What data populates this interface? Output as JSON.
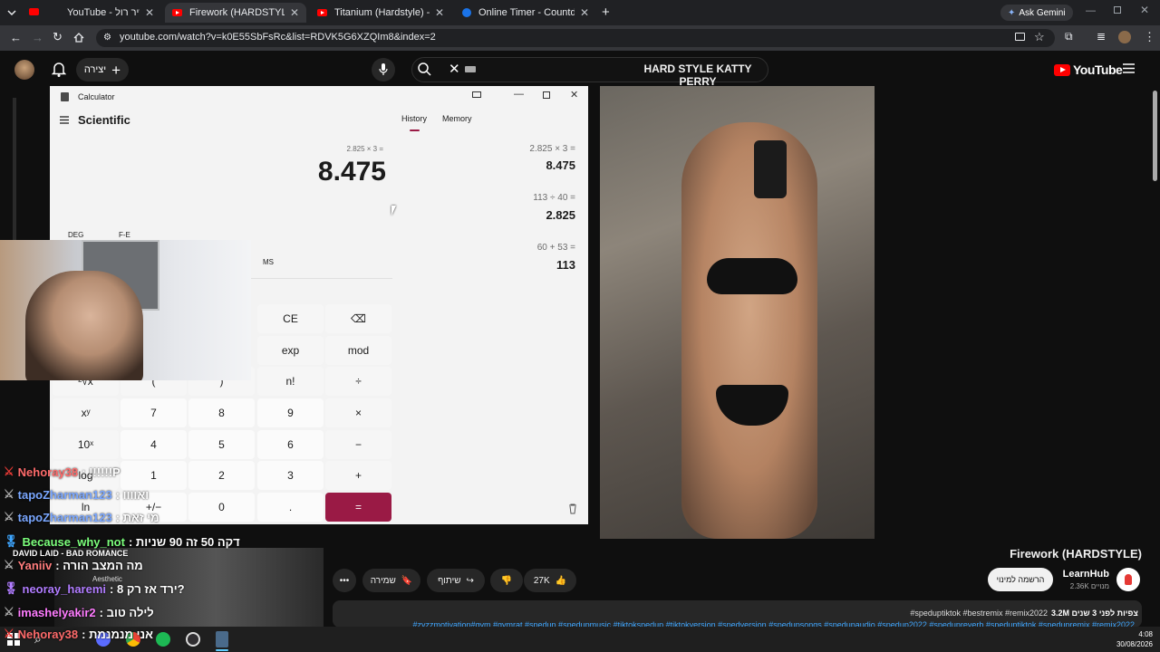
{
  "browser": {
    "tabs": [
      {
        "label": "YouTube - אבא קריר רול"
      },
      {
        "label": "Firework (HARDSTYLE) - YouTube"
      },
      {
        "label": "Titanium (Hardstyle) - YouTube"
      },
      {
        "label": "Online Timer - Countdown - vC"
      }
    ],
    "ask_gemini": "Ask Gemini",
    "url": "youtube.com/watch?v=k0E55SbFsRc&list=RDVK5G6XZQIm8&index=2"
  },
  "youtube": {
    "create_label": "יצירה",
    "search_query": "HARD STYLE KATTY PERRY",
    "logo": "YouTube",
    "video_title": "Firework (HARDSTYLE)",
    "channel_name": "LearnHub",
    "subscribers": "2.36K מנויים",
    "subscribe_label": "הרשמה למינוי",
    "likes": "27K",
    "share_label": "שיתוף",
    "save_label": "שמירה",
    "views_line": "3.2M צפיות לפני 3 שנים",
    "hashtags_1": "#speduptiktok #bestremix #remix2022",
    "hashtags_2": "#zyzzmotivation#gym #gymrat #spedup #spedupmusic #tiktokspedup #tiktokversion #spedversion #spedupsongs #spedupaudio #spedup2022 #spedupreverb #speduptiktok #spedupremix #remix2022"
  },
  "calculator": {
    "title": "Calculator",
    "mode": "Scientific",
    "tab_history": "History",
    "tab_memory": "Memory",
    "expression": "2.825 × 3 =",
    "display": "8.475",
    "deg": "DEG",
    "fe": "F-E",
    "ms": "MS",
    "history": [
      {
        "expr": "2.825  ×  3 =",
        "result": "8.475"
      },
      {
        "expr": "113  ÷  40 =",
        "result": "2.825"
      },
      {
        "expr": "60  +  53 =",
        "result": "113"
      }
    ],
    "keys": {
      "ce": "CE",
      "back": "⌫",
      "exp": "exp",
      "mod": "mod",
      "sqrt": "²√x",
      "lparen": "(",
      "rparen": ")",
      "fact": "n!",
      "div": "÷",
      "xy": "xʸ",
      "k7": "7",
      "k8": "8",
      "k9": "9",
      "mul": "×",
      "tenx": "10ˣ",
      "k4": "4",
      "k5": "5",
      "k6": "6",
      "minus": "−",
      "log": "log",
      "k1": "1",
      "k2": "2",
      "k3": "3",
      "plus": "+",
      "ln": "ln",
      "neg": "+/−",
      "k0": "0",
      "dot": ".",
      "eq": "="
    }
  },
  "chat": [
    {
      "nick": "Nehoray38",
      "msg": ": !!!!!!P",
      "color": "#ff6b6b"
    },
    {
      "nick": "tapoZharman123",
      "msg": ": ואוווו",
      "color": "#7aa7ff"
    },
    {
      "nick": "tapoZharman123",
      "msg": ": מי זאת",
      "color": "#7aa7ff"
    },
    {
      "nick": "Because_why_not",
      "msg": ": דקה 50 זה 90 שניות",
      "color": "#7cff7c"
    },
    {
      "nick": "Yaniiv",
      "msg": ": מה המצב הורה",
      "color": "#ff7c7c"
    },
    {
      "nick": "neoray_haremi",
      "msg": ": ירד אז רק 8?",
      "color": "#b07cff"
    },
    {
      "nick": "imashelyakir2",
      "msg": ": לילה טוב",
      "color": "#ff7cff"
    },
    {
      "nick": "Nehoray38",
      "msg": ": אני מנמנמת",
      "color": "#ff6b6b"
    }
  ],
  "music_overlay": {
    "now_playing": "DAVID LAID - BAD ROMANCE",
    "subtitle": "Aesthetic"
  },
  "taskbar": {
    "time": "4:08",
    "date": "30/08/2026"
  }
}
